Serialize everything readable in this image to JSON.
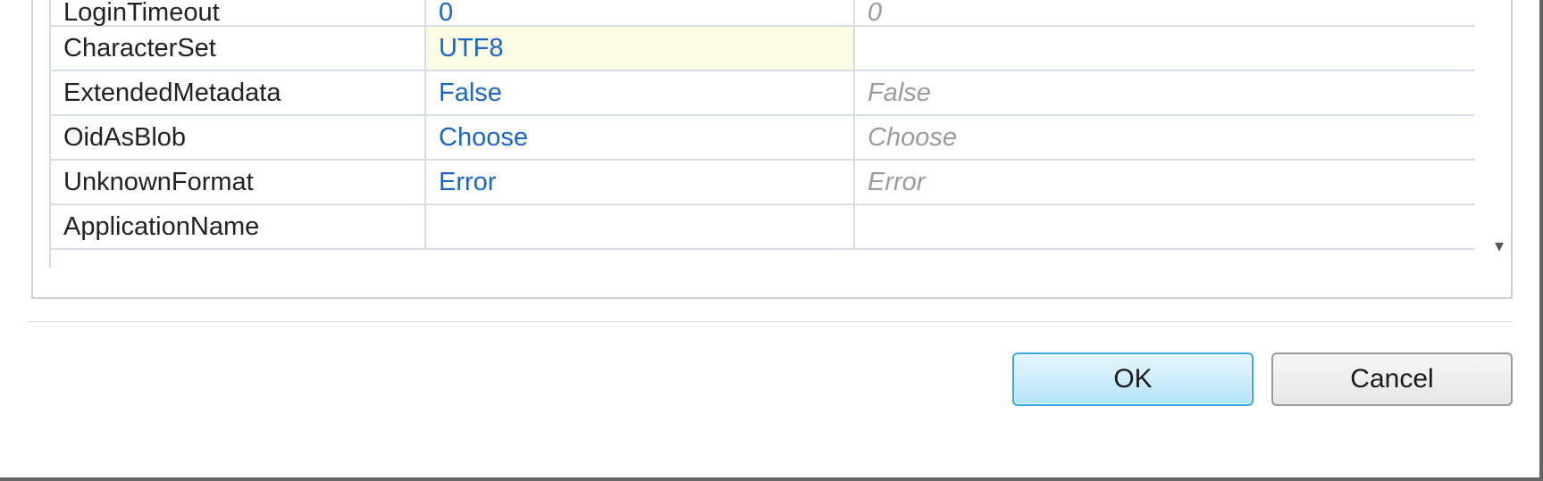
{
  "grid": {
    "rows": [
      {
        "name": "LoginTimeout",
        "value": "0",
        "default": "0",
        "highlight": false
      },
      {
        "name": "CharacterSet",
        "value": "UTF8",
        "default": "",
        "highlight": true
      },
      {
        "name": "ExtendedMetadata",
        "value": "False",
        "default": "False",
        "highlight": false
      },
      {
        "name": "OidAsBlob",
        "value": "Choose",
        "default": "Choose",
        "highlight": false
      },
      {
        "name": "UnknownFormat",
        "value": "Error",
        "default": "Error",
        "highlight": false
      },
      {
        "name": "ApplicationName",
        "value": "",
        "default": "",
        "highlight": false
      }
    ]
  },
  "scroll": {
    "down_glyph": "▾"
  },
  "buttons": {
    "ok": "OK",
    "cancel": "Cancel"
  }
}
